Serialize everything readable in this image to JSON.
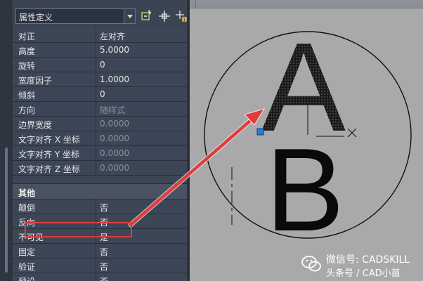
{
  "toolbar": {
    "combo_value": "属性定义",
    "icons": [
      "quick-select-icon",
      "pick-objects-icon",
      "toggle-pickadd-icon"
    ]
  },
  "properties": {
    "rows_top": [
      {
        "key": "对正",
        "value": "左对齐",
        "dim": false
      },
      {
        "key": "高度",
        "value": "5.0000",
        "dim": false
      },
      {
        "key": "旋转",
        "value": "0",
        "dim": false
      },
      {
        "key": "宽度因子",
        "value": "1.0000",
        "dim": false
      },
      {
        "key": "倾斜",
        "value": "0",
        "dim": false
      },
      {
        "key": "方向",
        "value": "随样式",
        "dim": true
      },
      {
        "key": "边界宽度",
        "value": "0.0000",
        "dim": true
      },
      {
        "key": "文字对齐 X 坐标",
        "value": "0.0000",
        "dim": true
      },
      {
        "key": "文字对齐 Y 坐标",
        "value": "0.0000",
        "dim": true
      },
      {
        "key": "文字对齐 Z 坐标",
        "value": "0.0000",
        "dim": true
      }
    ],
    "section_title": "其他",
    "rows_bottom": [
      {
        "key": "颠倒",
        "value": "否"
      },
      {
        "key": "反向",
        "value": "否"
      },
      {
        "key": "不可见",
        "value": "是"
      },
      {
        "key": "固定",
        "value": "否"
      },
      {
        "key": "验证",
        "value": "否"
      },
      {
        "key": "预设",
        "value": "否"
      }
    ]
  },
  "drawing": {
    "letter_top": "A",
    "letter_bottom": "B",
    "highlight_color": "#e23b3b",
    "grip_color": "#2b7bd6"
  },
  "watermark": {
    "line1": "微信号: CADSKILL",
    "line2": "头条号 / CAD小苗"
  }
}
